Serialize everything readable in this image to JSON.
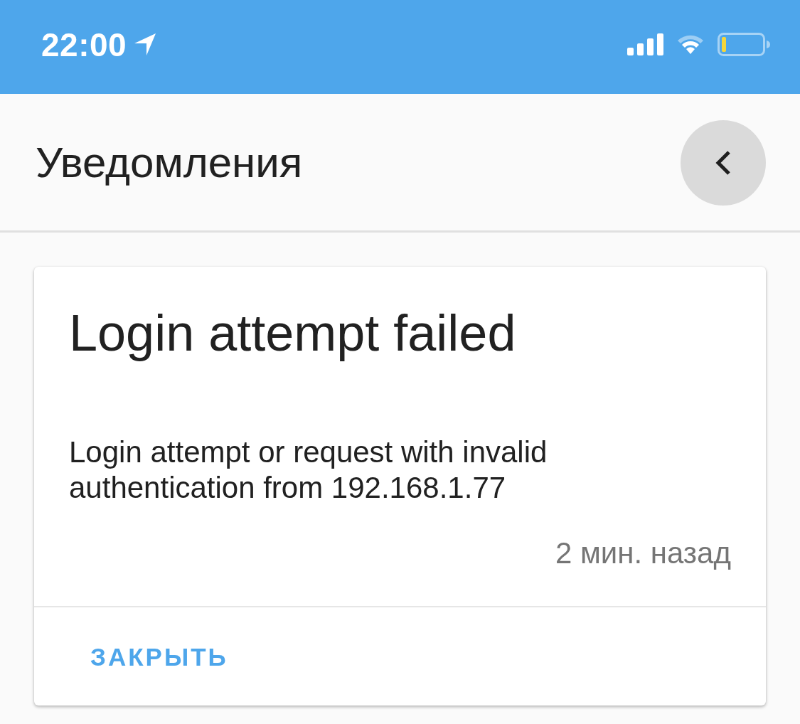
{
  "status_bar": {
    "time": "22:00"
  },
  "header": {
    "title": "Уведомления"
  },
  "notifications": [
    {
      "title": "Login attempt failed",
      "message": "Login attempt or request with invalid authentication from 192.168.1.77",
      "time": "2 мин. назад",
      "actions": [
        "ЗАКРЫТЬ"
      ]
    }
  ]
}
